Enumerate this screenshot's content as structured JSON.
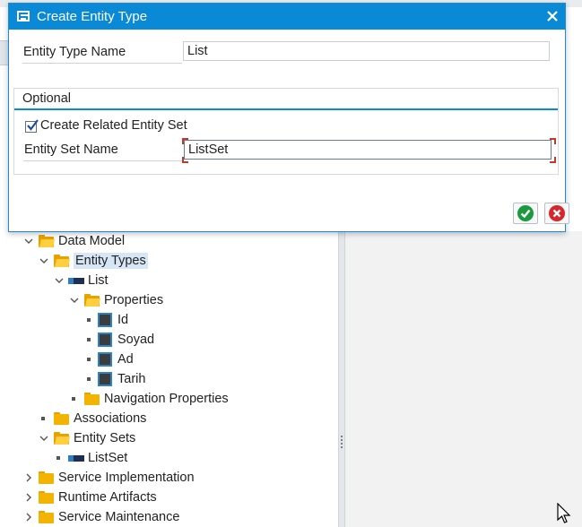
{
  "dialog": {
    "title": "Create Entity Type",
    "entity_type_name_label": "Entity Type Name",
    "entity_type_name_value": "List",
    "optional_group_title": "Optional",
    "create_related_entity_set_label": "Create Related Entity Set",
    "create_related_entity_set_checked": true,
    "entity_set_name_label": "Entity Set Name",
    "entity_set_name_value": "ListSet"
  },
  "tree": {
    "data_model": "Data Model",
    "entity_types": "Entity Types",
    "list": "List",
    "properties": "Properties",
    "property_items": [
      "Id",
      "Soyad",
      "Ad",
      "Tarih"
    ],
    "navigation_properties": "Navigation Properties",
    "associations": "Associations",
    "entity_sets": "Entity Sets",
    "list_set": "ListSet",
    "service_implementation": "Service Implementation",
    "runtime_artifacts": "Runtime Artifacts",
    "service_maintenance": "Service Maintenance"
  },
  "colors": {
    "title_bar": "#0a8ad6",
    "confirm": "#1a9a3c",
    "cancel": "#d9262c",
    "folder": "#f2b400"
  }
}
